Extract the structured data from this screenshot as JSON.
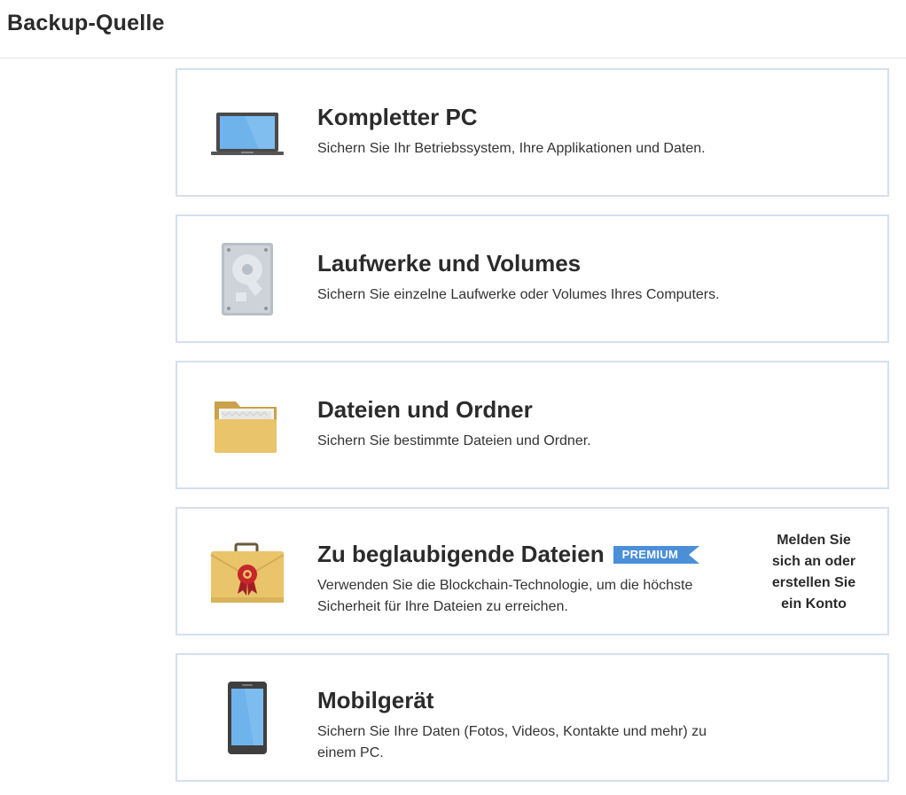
{
  "header": {
    "title": "Backup-Quelle"
  },
  "sources": [
    {
      "title": "Kompletter PC",
      "description": "Sichern Sie Ihr Betriebssystem, Ihre Applikationen und Daten.",
      "icon": "laptop-icon"
    },
    {
      "title": "Laufwerke und Volumes",
      "description": "Sichern Sie einzelne Laufwerke oder Volumes Ihres Computers.",
      "icon": "hard-drive-icon"
    },
    {
      "title": "Dateien und Ordner",
      "description": "Sichern Sie bestimmte Dateien und Ordner.",
      "icon": "folder-icon"
    },
    {
      "title": "Zu beglaubigende Dateien",
      "badge": "PREMIUM",
      "description": "Verwenden Sie die Blockchain-Technologie, um die höchste Sicherheit für Ihre Dateien zu erreichen.",
      "login_text": "Melden Sie sich an oder erstellen Sie ein Konto",
      "icon": "certified-briefcase-icon"
    },
    {
      "title": "Mobilgerät",
      "description": "Sichern Sie Ihre Daten (Fotos, Videos, Kontakte und mehr) zu einem PC.",
      "icon": "smartphone-icon"
    }
  ],
  "colors": {
    "card_border": "#d5dff0",
    "badge_blue": "#4a8fd8",
    "screen_blue": "#64aee6",
    "folder_yellow": "#e9c46a",
    "seal_red": "#c8262b"
  }
}
